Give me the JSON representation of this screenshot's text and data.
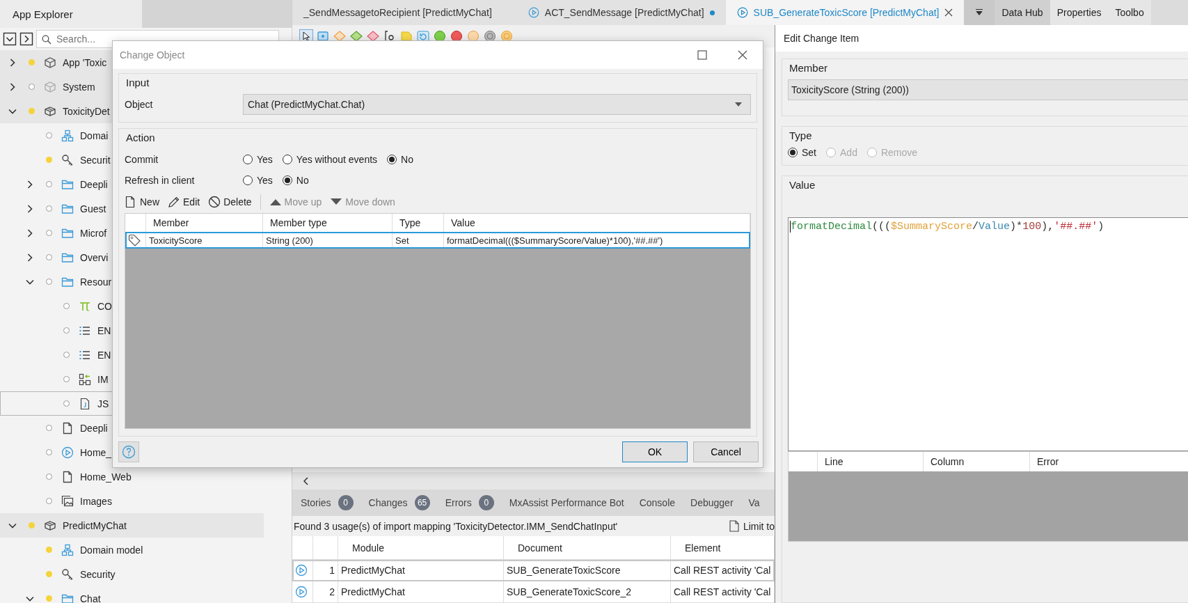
{
  "explorer": {
    "title": "App Explorer",
    "search": {
      "placeholder": "Search..."
    },
    "tree": [
      {
        "label": "App 'Toxic",
        "kind": "app",
        "changed": true,
        "selected": false,
        "expanded": false
      },
      {
        "label": "System",
        "kind": "system",
        "changed": false,
        "selected": false,
        "expanded": false
      },
      {
        "label": "ToxicityDet",
        "kind": "module",
        "changed": true,
        "selected": false,
        "expanded": true,
        "children": [
          {
            "label": "Domai",
            "kind": "domain",
            "changed": false,
            "selected": false
          },
          {
            "label": "Securit",
            "kind": "security",
            "changed": true,
            "selected": false
          },
          {
            "label": "Deepli",
            "kind": "folder",
            "changed": false,
            "selected": false,
            "expanded": false
          },
          {
            "label": "Guest",
            "kind": "folder",
            "changed": false,
            "selected": false,
            "expanded": false
          },
          {
            "label": "Microf",
            "kind": "folder",
            "changed": false,
            "selected": false,
            "expanded": false
          },
          {
            "label": "Overvi",
            "kind": "folder",
            "changed": false,
            "selected": false,
            "expanded": false
          },
          {
            "label": "Resour",
            "kind": "folder",
            "changed": false,
            "selected": false,
            "expanded": true,
            "children": [
              {
                "label": "CO",
                "kind": "constant",
                "changed": false,
                "selected": false
              },
              {
                "label": "EN",
                "kind": "enumeration",
                "changed": false,
                "selected": false
              },
              {
                "label": "EN",
                "kind": "enumeration",
                "changed": false,
                "selected": false
              },
              {
                "label": "IM",
                "kind": "import-mapping",
                "changed": false,
                "selected": false
              },
              {
                "label": "JS",
                "kind": "json",
                "changed": false,
                "selected": true
              }
            ]
          },
          {
            "label": "Deepli",
            "kind": "page",
            "changed": false,
            "selected": false
          },
          {
            "label": "Home_",
            "kind": "microflow",
            "changed": false,
            "selected": false
          },
          {
            "label": "Home_Web",
            "kind": "page",
            "changed": false,
            "selected": false
          },
          {
            "label": "Images",
            "kind": "images",
            "changed": false,
            "selected": false
          }
        ]
      },
      {
        "label": "PredictMyChat",
        "kind": "module",
        "changed": true,
        "selected": false,
        "expanded": true,
        "children": [
          {
            "label": "Domain model",
            "kind": "domain",
            "changed": true,
            "selected": false
          },
          {
            "label": "Security",
            "kind": "security",
            "changed": true,
            "selected": false
          },
          {
            "label": "Chat",
            "kind": "folder",
            "changed": true,
            "selected": false,
            "expanded": true
          }
        ]
      }
    ]
  },
  "doc_tabs": [
    {
      "label": "_SendMessagetoRecipient [PredictMyChat]",
      "kind": "plain",
      "selected": false,
      "unsaved": false
    },
    {
      "label": "ACT_SendMessage [PredictMyChat]",
      "kind": "microflow",
      "selected": false,
      "unsaved": true
    },
    {
      "label": "SUB_GenerateToxicScore [PredictMyChat]",
      "kind": "microflow",
      "selected": true,
      "unsaved": false
    }
  ],
  "side_tabs": [
    {
      "label": "Data Hub",
      "selected": true
    },
    {
      "label": "Properties",
      "selected": false
    },
    {
      "label": "Toolbo",
      "selected": false
    }
  ],
  "bottom_panel": {
    "tabs": [
      {
        "label": "Stories",
        "badge": "0"
      },
      {
        "label": "Changes",
        "badge": "65"
      },
      {
        "label": "Errors",
        "badge": "0"
      },
      {
        "label": "MxAssist Performance Bot"
      },
      {
        "label": "Console"
      },
      {
        "label": "Debugger"
      },
      {
        "label": "Va"
      }
    ],
    "message": "Found 3 usage(s) of import mapping 'ToxicityDetector.IMM_SendChatInput'",
    "limit_label": "Limit to",
    "columns": [
      "Module",
      "Document",
      "Element"
    ],
    "rows": [
      {
        "number": "1",
        "module": "PredictMyChat",
        "document": "SUB_GenerateToxicScore",
        "element": "Call REST activity 'Cal",
        "selected": true
      },
      {
        "number": "2",
        "module": "PredictMyChat",
        "document": "SUB_GenerateToxicScore_2",
        "element": "Call REST activity 'Cal",
        "selected": false
      }
    ]
  },
  "change_object": {
    "title": "Change Object",
    "input_group": "Input",
    "object_label": "Object",
    "object_value": "Chat (PredictMyChat.Chat)",
    "action_group": "Action",
    "radio_rows": [
      {
        "label": "Commit",
        "options": [
          {
            "label": "Yes",
            "selected": false
          },
          {
            "label": "Yes without events",
            "selected": false
          },
          {
            "label": "No",
            "selected": true
          }
        ]
      },
      {
        "label": "Refresh in client",
        "options": [
          {
            "label": "Yes",
            "selected": false
          },
          {
            "label": "No",
            "selected": true
          }
        ]
      }
    ],
    "toolbar": [
      {
        "label": "New",
        "kind": "new",
        "disabled": false
      },
      {
        "label": "Edit",
        "kind": "edit",
        "disabled": false
      },
      {
        "label": "Delete",
        "kind": "delete",
        "disabled": false
      },
      {
        "label": "Move up",
        "kind": "up",
        "disabled": true
      },
      {
        "label": "Move down",
        "kind": "down",
        "disabled": true
      }
    ],
    "columns": [
      "Member",
      "Member type",
      "Type",
      "Value"
    ],
    "rows": [
      {
        "member": "ToxicityScore",
        "member_type": "String (200)",
        "type": "Set",
        "value": "formatDecimal((($SummaryScore/Value)*100),'##.##')",
        "selected": true
      }
    ],
    "buttons": [
      {
        "label": "OK",
        "kind": "primary"
      },
      {
        "label": "Cancel",
        "kind": "normal"
      }
    ]
  },
  "edit_change_item": {
    "title": "Edit Change Item",
    "member_group": "Member",
    "member_value": "ToxicityScore (String (200))",
    "type_group": "Type",
    "type_options": [
      {
        "label": "Set",
        "selected": true,
        "disabled": false
      },
      {
        "label": "Add",
        "selected": false,
        "disabled": true
      },
      {
        "label": "Remove",
        "selected": false,
        "disabled": true
      }
    ],
    "value_group": "Value",
    "code_tokens": [
      {
        "text": "formatDecimal",
        "kind": "function"
      },
      {
        "text": "(((",
        "kind": "punct"
      },
      {
        "text": "$SummaryScore",
        "kind": "variable"
      },
      {
        "text": "/",
        "kind": "punct"
      },
      {
        "text": "Value",
        "kind": "attribute"
      },
      {
        "text": ")*",
        "kind": "punct"
      },
      {
        "text": "100",
        "kind": "number"
      },
      {
        "text": "),",
        "kind": "punct"
      },
      {
        "text": "'##.##'",
        "kind": "string"
      },
      {
        "text": ")",
        "kind": "punct"
      }
    ],
    "error_columns": [
      "Line",
      "Column",
      "Error"
    ]
  }
}
